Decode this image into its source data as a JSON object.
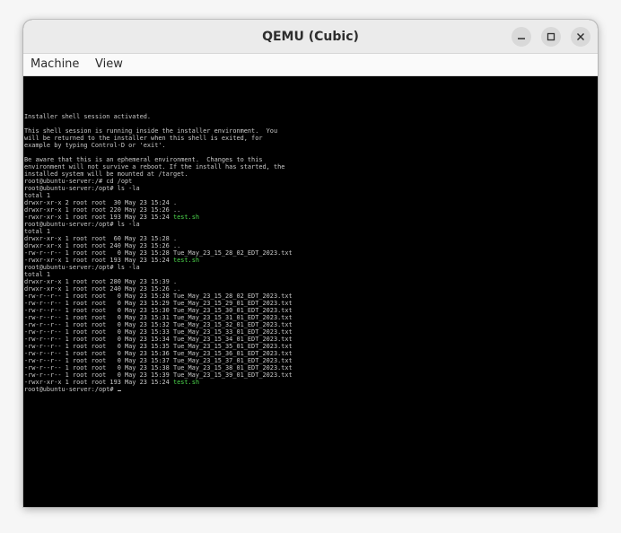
{
  "window": {
    "title": "QEMU (Cubic)"
  },
  "menubar": {
    "machine_label": "Machine",
    "view_label": "View"
  },
  "terminal": {
    "lines": [
      "Installer shell session activated.",
      "",
      "This shell session is running inside the installer environment.  You",
      "will be returned to the installer when this shell is exited, for",
      "example by typing Control-D or 'exit'.",
      "",
      "Be aware that this is an ephemeral environment.  Changes to this",
      "environment will not survive a reboot. If the install has started, the",
      "installed system will be mounted at /target.",
      "root@ubuntu-server:/# cd /opt",
      "root@ubuntu-server:/opt# ls -la",
      "total 1",
      "drwxr-xr-x 2 root root  30 May 23 15:24 .",
      "drwxr-xr-x 1 root root 220 May 23 15:26 ..",
      "-rwxr-xr-x 1 root root 193 May 23 15:24 |test.sh",
      "root@ubuntu-server:/opt# ls -la",
      "total 1",
      "drwxr-xr-x 1 root root  60 May 23 15:28 .",
      "drwxr-xr-x 1 root root 240 May 23 15:26 ..",
      "-rw-r--r-- 1 root root   0 May 23 15:28 Tue_May_23_15_28_02_EDT_2023.txt",
      "-rwxr-xr-x 1 root root 193 May 23 15:24 |test.sh",
      "root@ubuntu-server:/opt# ls -la",
      "total 1",
      "drwxr-xr-x 1 root root 280 May 23 15:39 .",
      "drwxr-xr-x 1 root root 240 May 23 15:26 ..",
      "-rw-r--r-- 1 root root   0 May 23 15:28 Tue_May_23_15_28_02_EDT_2023.txt",
      "-rw-r--r-- 1 root root   0 May 23 15:29 Tue_May_23_15_29_01_EDT_2023.txt",
      "-rw-r--r-- 1 root root   0 May 23 15:30 Tue_May_23_15_30_01_EDT_2023.txt",
      "-rw-r--r-- 1 root root   0 May 23 15:31 Tue_May_23_15_31_01_EDT_2023.txt",
      "-rw-r--r-- 1 root root   0 May 23 15:32 Tue_May_23_15_32_01_EDT_2023.txt",
      "-rw-r--r-- 1 root root   0 May 23 15:33 Tue_May_23_15_33_01_EDT_2023.txt",
      "-rw-r--r-- 1 root root   0 May 23 15:34 Tue_May_23_15_34_01_EDT_2023.txt",
      "-rw-r--r-- 1 root root   0 May 23 15:35 Tue_May_23_15_35_01_EDT_2023.txt",
      "-rw-r--r-- 1 root root   0 May 23 15:36 Tue_May_23_15_36_01_EDT_2023.txt",
      "-rw-r--r-- 1 root root   0 May 23 15:37 Tue_May_23_15_37_01_EDT_2023.txt",
      "-rw-r--r-- 1 root root   0 May 23 15:38 Tue_May_23_15_38_01_EDT_2023.txt",
      "-rw-r--r-- 1 root root   0 May 23 15:39 Tue_May_23_15_39_01_EDT_2023.txt",
      "-rwxr-xr-x 1 root root 193 May 23 15:24 |test.sh",
      "root@ubuntu-server:/opt# "
    ],
    "exec_color": "#4cd64c",
    "text_color": "#c8c8c8"
  },
  "icons": {
    "minimize": "minimize-icon",
    "maximize": "maximize-icon",
    "close": "close-icon"
  }
}
